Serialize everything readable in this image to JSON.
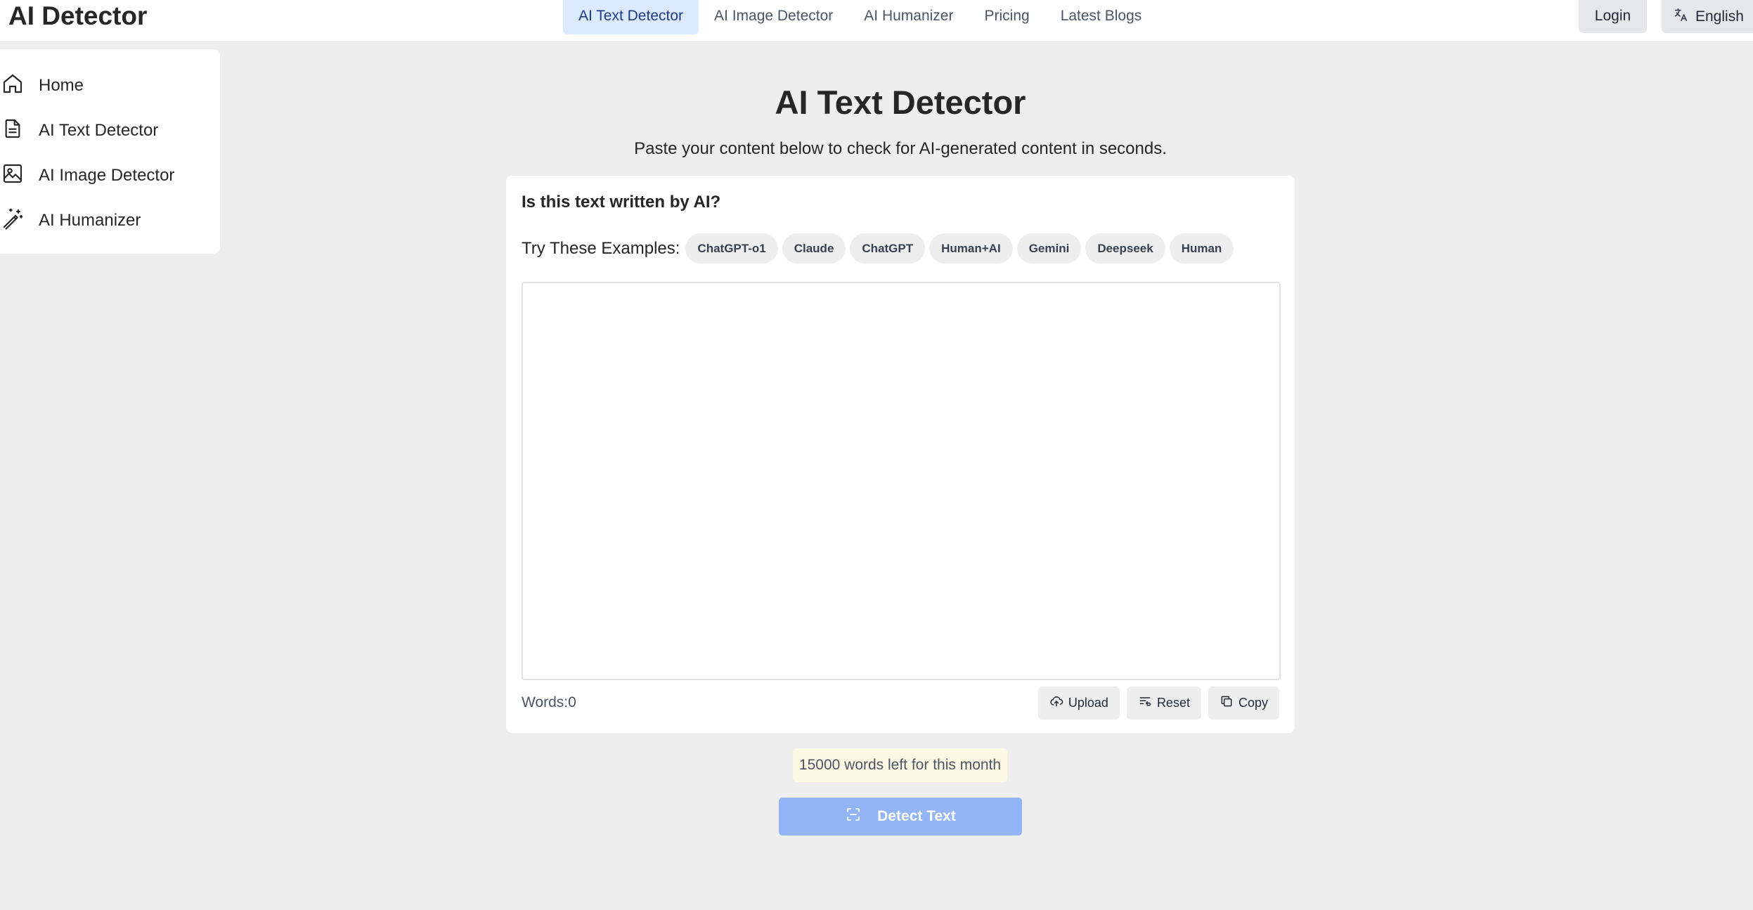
{
  "header": {
    "brand": "AI Detector",
    "nav": [
      {
        "label": "AI Text Detector",
        "active": true
      },
      {
        "label": "AI Image Detector",
        "active": false
      },
      {
        "label": "AI Humanizer",
        "active": false
      },
      {
        "label": "Pricing",
        "active": false
      },
      {
        "label": "Latest Blogs",
        "active": false
      }
    ],
    "login_label": "Login",
    "language_label": "English",
    "language_icon": "translate-icon"
  },
  "sidebar": {
    "items": [
      {
        "label": "Home",
        "icon": "home-icon"
      },
      {
        "label": "AI Text Detector",
        "icon": "document-icon"
      },
      {
        "label": "AI Image Detector",
        "icon": "image-icon"
      },
      {
        "label": "AI Humanizer",
        "icon": "magic-wand-icon"
      }
    ]
  },
  "main": {
    "title": "AI Text Detector",
    "subtitle": "Paste your content below to check for AI-generated content in seconds.",
    "card": {
      "question": "Is this text written by AI?",
      "examples_label": "Try These Examples:",
      "examples": [
        "ChatGPT-o1",
        "Claude",
        "ChatGPT",
        "Human+AI",
        "Gemini",
        "Deepseek",
        "Human"
      ],
      "textarea_value": "",
      "textarea_placeholder": "",
      "word_count": "Words:0",
      "actions": {
        "upload": "Upload",
        "reset": "Reset",
        "copy": "Copy"
      }
    },
    "quota_text": "15000 words left for this month",
    "detect_label": "Detect Text"
  },
  "colors": {
    "page_bg": "#eeeeee",
    "active_nav_bg": "#dbeafe",
    "detect_button": "#93b4f5",
    "quota_bg": "#fdf8e4"
  }
}
